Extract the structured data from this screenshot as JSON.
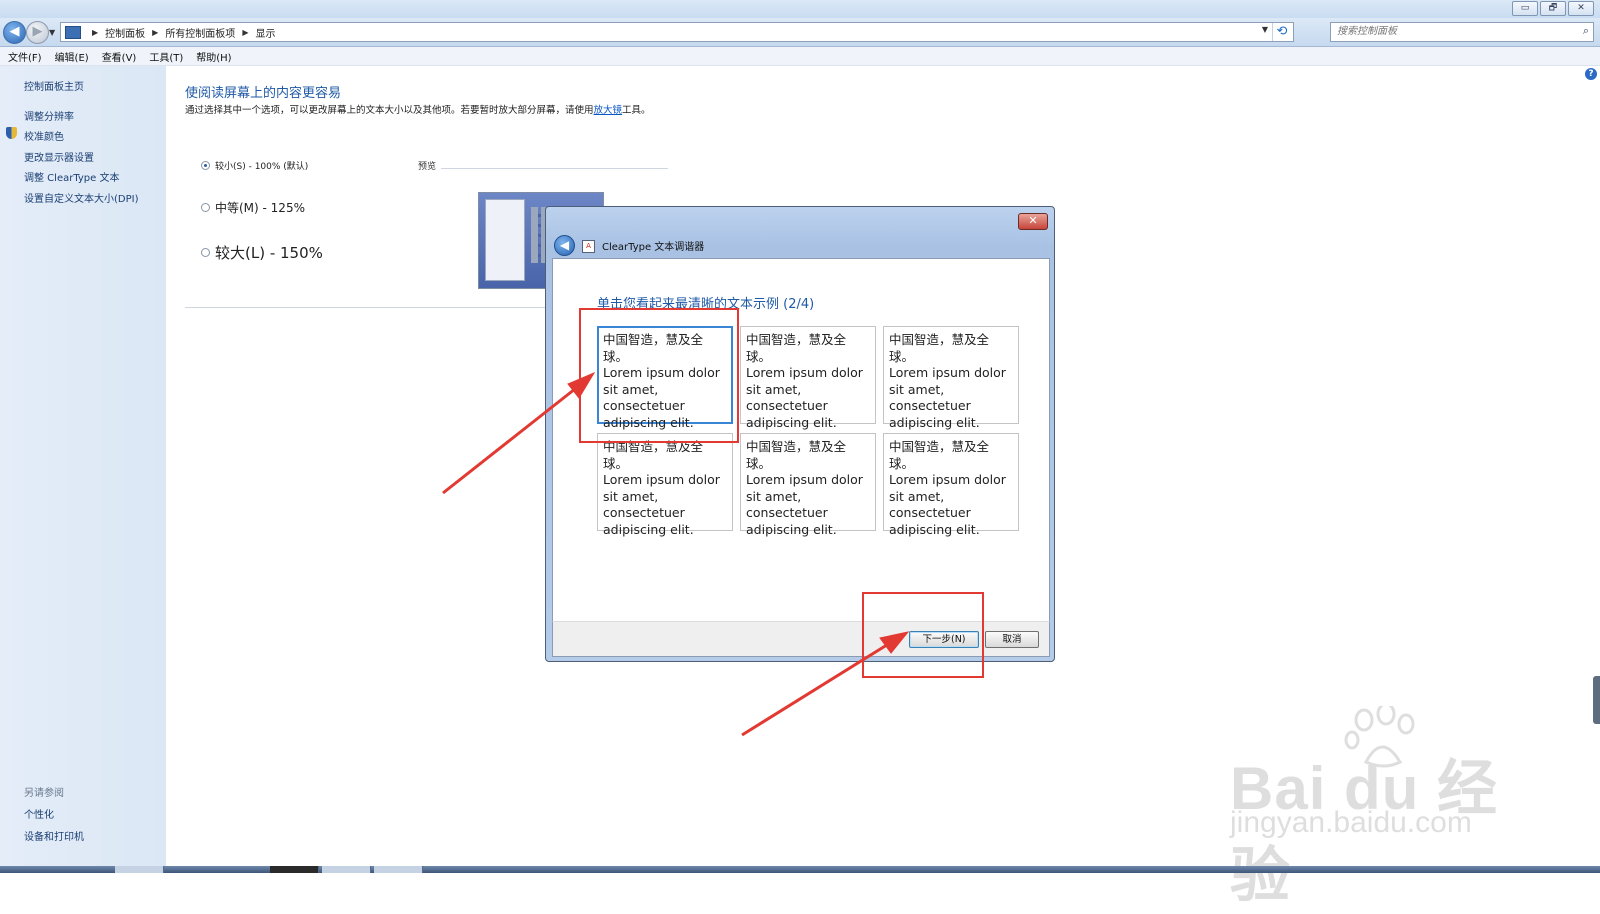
{
  "window": {
    "controls": [
      "▭",
      "🗗",
      "✕"
    ]
  },
  "address": {
    "crumbs": [
      "控制面板",
      "所有控制面板项",
      "显示"
    ],
    "search_placeholder": "搜索控制面板"
  },
  "menu": [
    "文件(F)",
    "编辑(E)",
    "查看(V)",
    "工具(T)",
    "帮助(H)"
  ],
  "sidebar": {
    "home": "控制面板主页",
    "items": [
      "调整分辨率",
      "校准颜色",
      "更改显示器设置",
      "调整 ClearType 文本",
      "设置自定义文本大小(DPI)"
    ],
    "see_also_title": "另请参阅",
    "see_also": [
      "个性化",
      "设备和打印机"
    ]
  },
  "main": {
    "heading": "使阅读屏幕上的内容更容易",
    "desc_prefix": "通过选择其中一个选项，可以更改屏幕上的文本大小以及其他项。若要暂时放大部分屏幕，请使用",
    "desc_link": "放大镜",
    "desc_suffix": "工具。",
    "options": [
      "较小(S) - 100% (默认)",
      "中等(M) - 125%",
      "较大(L) - 150%"
    ],
    "selected_option": 0,
    "preview_label": "预览"
  },
  "dialog": {
    "title": "ClearType 文本调谐器",
    "instruction": "单击您看起来最清晰的文本示例 (2/4)",
    "sample_text": "中国智造，慧及全球。\nLorem ipsum dolor\nsit amet,\nconsectetuer\nadipiscing elit.",
    "selected_sample": 0,
    "next_label": "下一步(N)",
    "cancel_label": "取消",
    "close_glyph": "✕"
  },
  "icons": {
    "back": "back-arrow-icon",
    "forward": "forward-arrow-icon",
    "search": "search-icon",
    "help": "help-icon",
    "shield": "uac-shield-icon"
  },
  "watermark": {
    "logo": "Bai du 经验",
    "url": "jingyan.baidu.com"
  },
  "colors": {
    "link": "#1f5aa6",
    "annotation": "#e23a32"
  }
}
